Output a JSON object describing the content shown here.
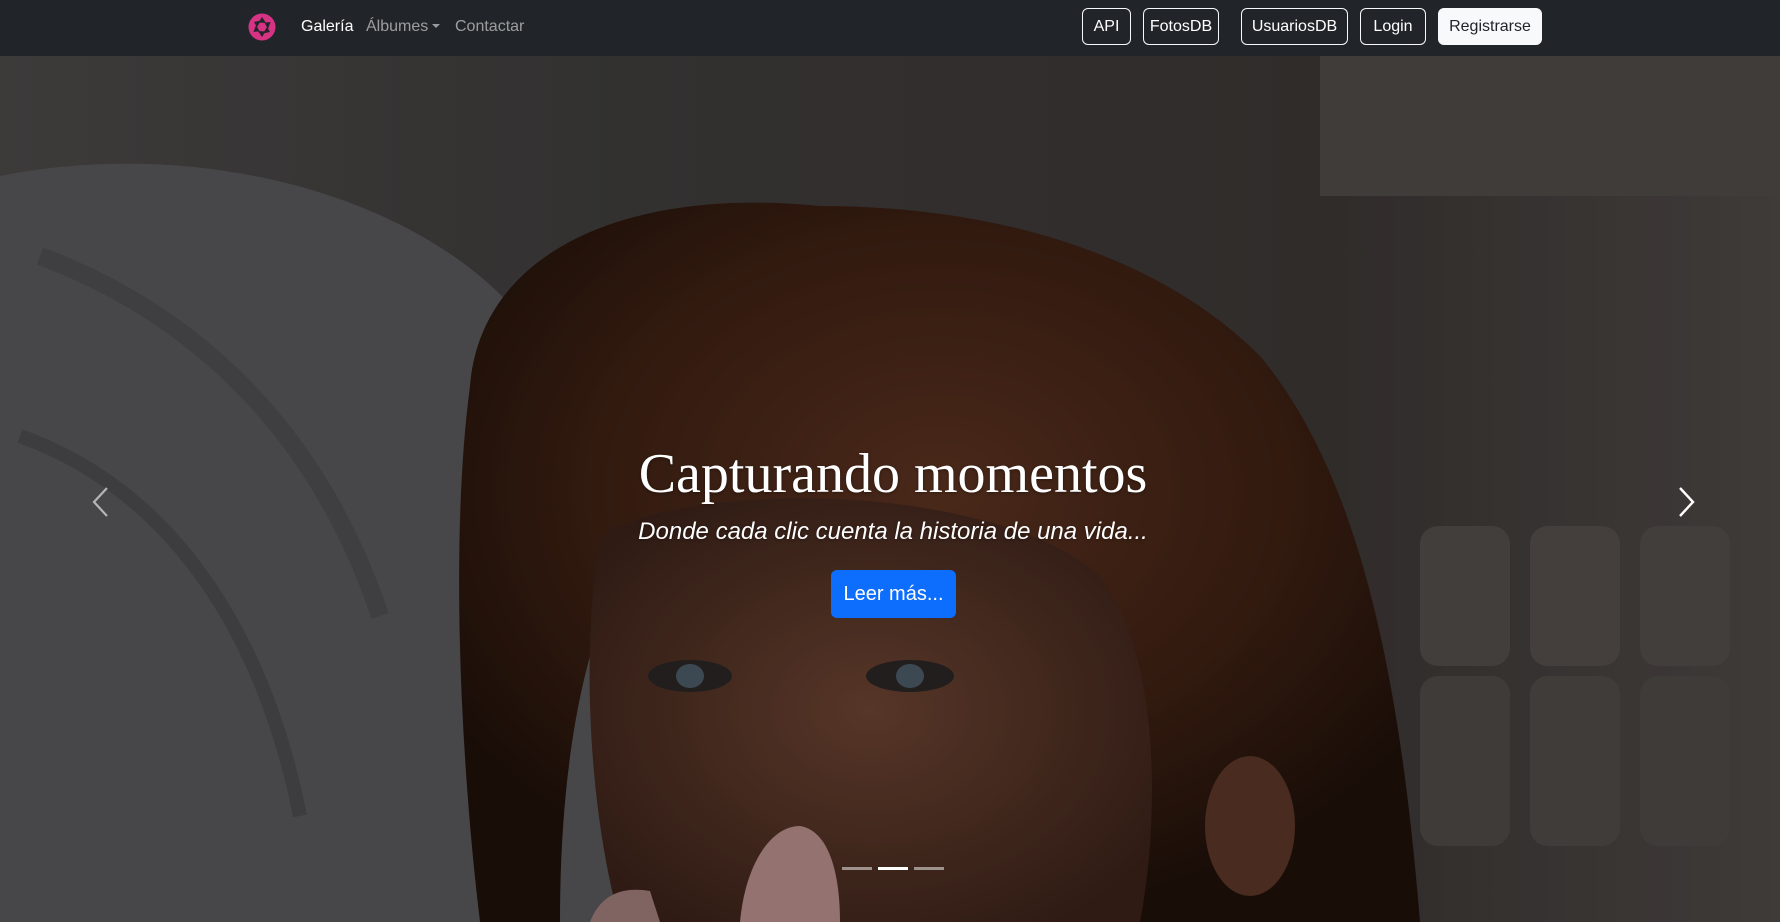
{
  "navbar": {
    "brand_icon": "camera-aperture-icon",
    "brand_color": "#d63384",
    "links": [
      {
        "label": "Galería",
        "active": true
      },
      {
        "label": "Álbumes",
        "dropdown": true
      },
      {
        "label": "Contactar"
      }
    ],
    "buttons": {
      "api": "API",
      "fotos": "FotosDB",
      "usuarios": "UsuariosDB",
      "login": "Login",
      "register": "Registrarse"
    }
  },
  "carousel": {
    "title": "Capturando momentos",
    "subtitle": "Donde cada clic cuenta la historia de una vida...",
    "cta": "Leer más...",
    "cta_color": "#0d6efd",
    "prev_icon": "chevron-left-icon",
    "next_icon": "chevron-right-icon",
    "slide_count": 3,
    "active_slide": 2
  }
}
